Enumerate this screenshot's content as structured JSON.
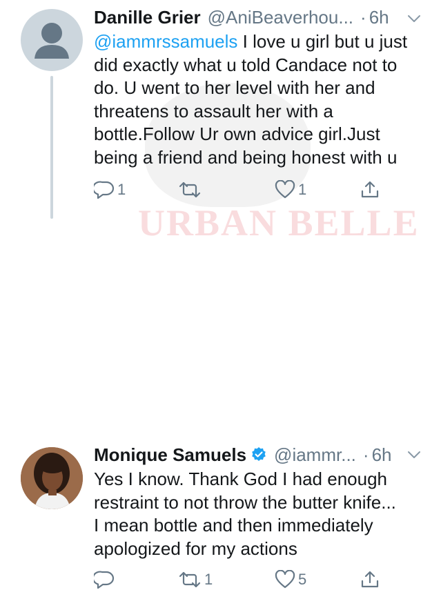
{
  "colors": {
    "text": "#14171a",
    "secondary": "#657786",
    "accent": "#1da1f2",
    "verified": "#1da1f2",
    "thread": "#ccd6dd"
  },
  "watermark": "URBAN BELLE",
  "tweets": [
    {
      "display_name": "Danille Grier",
      "handle": "@AniBeaverhou...",
      "dot": "·",
      "time": "6h",
      "avatar_icon": "default-avatar-icon",
      "lines": [
        {
          "mention": "@iammrssamuels",
          "text": " I love u girl but u just"
        },
        {
          "text": "did exactly what u told Candace not to"
        },
        {
          "text": "do. U went to her level with her and"
        },
        {
          "text": "threatens to assault her with a"
        },
        {
          "text": "bottle.Follow Ur own advice girl.Just"
        },
        {
          "text": "being a friend and being honest with u"
        }
      ],
      "actions": {
        "reply_count": "1",
        "retweet_count": "",
        "like_count": "1"
      }
    },
    {
      "display_name": "Monique Samuels",
      "verified": true,
      "handle": "@iammr...",
      "dot": "·",
      "time": "6h",
      "avatar_icon": "profile-photo",
      "lines": [
        {
          "text": "Yes I know. Thank God I had enough"
        },
        {
          "text": "restraint to not throw the butter knife..."
        },
        {
          "text": "I mean bottle and then immediately"
        },
        {
          "text": "apologized for my actions"
        }
      ],
      "actions": {
        "reply_count": "",
        "retweet_count": "1",
        "like_count": "5"
      }
    }
  ]
}
